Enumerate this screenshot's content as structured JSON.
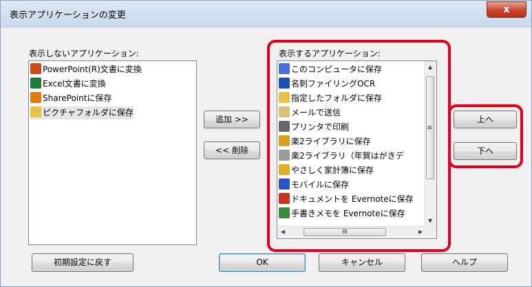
{
  "window": {
    "title": "表示アプリケーションの変更",
    "close_glyph": "x"
  },
  "left_list": {
    "label": "表示しないアプリケーション:",
    "items": [
      {
        "label": "PowerPoint(R)文書に変換",
        "icon": "powerpoint-icon",
        "color": "#c84b1b"
      },
      {
        "label": "Excel文書に変換",
        "icon": "excel-icon",
        "color": "#1d7a3a"
      },
      {
        "label": "SharePointに保存",
        "icon": "sharepoint-icon",
        "color": "#e07a10"
      },
      {
        "label": "ピクチャフォルダに保存",
        "icon": "folder-icon",
        "color": "#e8c04a"
      }
    ]
  },
  "right_list": {
    "label": "表示するアプリケーション:",
    "items": [
      {
        "label": "このコンピュータに保存",
        "icon": "computer-icon",
        "color": "#4b6fd6"
      },
      {
        "label": "名刺ファイリングOCR",
        "icon": "business-card-icon",
        "color": "#1f4fb5"
      },
      {
        "label": "指定したフォルダに保存",
        "icon": "folder-icon",
        "color": "#e8c04a"
      },
      {
        "label": "メールで送信",
        "icon": "mail-icon",
        "color": "#d9c27a"
      },
      {
        "label": "プリンタで印刷",
        "icon": "printer-icon",
        "color": "#666666"
      },
      {
        "label": "楽2ライブラリに保存",
        "icon": "library-icon",
        "color": "#d9a020"
      },
      {
        "label": "楽2ライブラリ（年賀はがきデ",
        "icon": "library-newyear-icon",
        "color": "#9a9a9a"
      },
      {
        "label": "やさしく家計簿に保存",
        "icon": "household-account-icon",
        "color": "#e0b020"
      },
      {
        "label": "モバイルに保存",
        "icon": "mobile-icon",
        "color": "#2a55c8"
      },
      {
        "label": "ドキュメントを Evernoteに保存",
        "icon": "pdf-evernote-icon",
        "color": "#c8321e"
      },
      {
        "label": "手書きメモを Evernoteに保存",
        "icon": "jpg-evernote-icon",
        "color": "#3a8a3a"
      }
    ],
    "scroll_marker": "III",
    "mid_marker": "≡"
  },
  "buttons": {
    "add": "追加 >>",
    "remove": "<< 削除",
    "up": "上へ",
    "down": "下へ",
    "reset": "初期設定に戻す",
    "ok": "OK",
    "cancel": "キャンセル",
    "help": "ヘルプ"
  },
  "colors": {
    "highlight_frame": "#e0001b",
    "dialog_bg": "#f0f0f0"
  }
}
